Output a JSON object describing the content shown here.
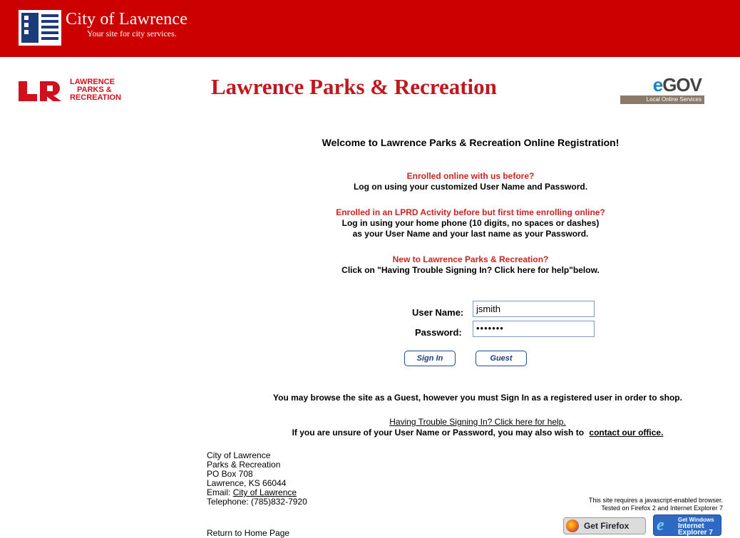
{
  "banner": {
    "city_name": "City of Lawrence",
    "tagline": "Your site for city services."
  },
  "header": {
    "lpr_logo_lines": [
      "LAWRENCE",
      "PARKS &",
      "RECREATION"
    ],
    "title": "Lawrence Parks & Recreation",
    "egov_word_e": "e",
    "egov_word_rest": "GOV",
    "egov_sub": "Local Online Services"
  },
  "main": {
    "welcome": "Welcome to Lawrence Parks & Recreation Online Registration!",
    "sections": [
      {
        "heading": "Enrolled online with us before?",
        "lines": [
          "Log on using your customized User Name and Password."
        ]
      },
      {
        "heading": "Enrolled in an LPRD Activity before but first time enrolling online?",
        "lines": [
          "Log in using your home phone (10 digits, no spaces or dashes)",
          "as your User Name and your last name as your Password."
        ]
      },
      {
        "heading": "New to Lawrence Parks & Recreation?",
        "lines": [
          "Click on \"Having Trouble Signing In? Click here for help\"below."
        ]
      }
    ]
  },
  "login": {
    "username_label": "User Name:",
    "username_value": "jsmith",
    "password_label": "Password:",
    "password_value": "•••••••",
    "signin_label": "Sign In",
    "guest_label": "Guest"
  },
  "footer": {
    "guest_note": "You may browse the site as a Guest, however you must Sign In as a registered user in order to shop.",
    "help_link": "Having Trouble Signing In? Click here for help.",
    "unsure_text": "If you are unsure of your User Name or Password, you may also wish to",
    "contact_link": "contact our office.",
    "address": {
      "org": "City of Lawrence",
      "dept": "Parks & Recreation",
      "po": "PO Box 708",
      "city": "Lawrence, KS 66044",
      "email_label": "Email:",
      "email_link": "City of Lawrence",
      "phone": "Telephone: (785)832-7920"
    },
    "home_link": "Return to Home Page",
    "req_note_1": "This site requires a javascript-enabled browser.",
    "req_note_2": "Tested on Firefox 2 and Internet Explorer 7",
    "firefox_badge": "Get Firefox",
    "ie_badge_lines": [
      "Get Windows",
      "Internet",
      "Explorer 7"
    ]
  },
  "colors": {
    "banner_red": "#cc0000",
    "title_red": "#c0181e",
    "heading_red": "#cc2222",
    "button_blue": "#1a3c80"
  }
}
